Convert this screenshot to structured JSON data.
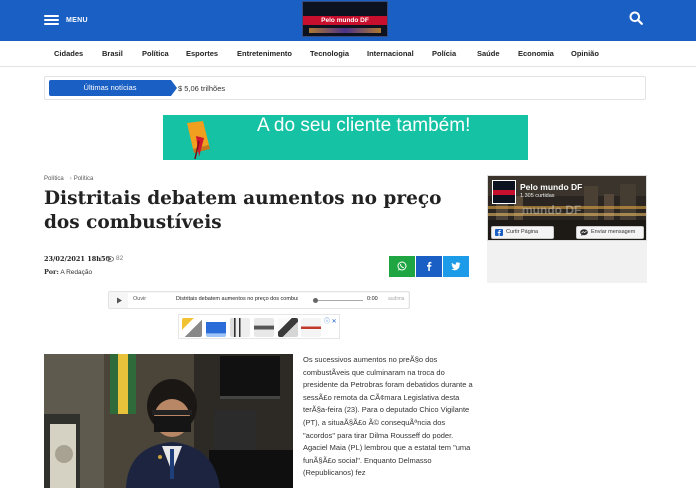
{
  "header": {
    "menu_label": "MENU",
    "logo_text": "Pelo mundo DF",
    "search_icon": "search-icon",
    "colors": {
      "brand_blue": "#1a5fc4",
      "logo_red": "#c8102e"
    }
  },
  "nav": {
    "items": [
      "Cidades",
      "Brasil",
      "Política",
      "Esportes",
      "Entretenimento",
      "Tecnologia",
      "Internacional",
      "Polícia",
      "Saúde",
      "Economia",
      "Opinião"
    ]
  },
  "ticker": {
    "label": "Últimas notícias",
    "text": "$ 5,06 trilhões"
  },
  "ad_banner": {
    "text": "A do seu cliente também!",
    "bg_color": "#15c2a4"
  },
  "article": {
    "breadcrumb": [
      "Política",
      "Política"
    ],
    "title": "Distritais debatem aumentos no preço dos combustíveis",
    "date": "23/02/2021 18h50",
    "views": "82",
    "author_prefix": "Por:",
    "author": "A Redação",
    "share": {
      "whatsapp_icon": "whatsapp-icon",
      "facebook_icon": "facebook-icon",
      "twitter_icon": "twitter-icon"
    },
    "audio": {
      "listen_label": "Ouvir",
      "title": "Distritais debatem aumentos no preço dos combustíveis",
      "time": "0:00",
      "brand": "audima"
    },
    "inline_ad_choice": "ⓘ ✕",
    "body": "Os sucessivos aumentos no preÃ§o dos combustÃveis que culminaram na troca do presidente da Petrobras foram debatidos durante a sessÃ£o remota da CÃ¢mara Legislativa desta terÃ§a-feira (23). Para o deputado Chico Vigilante (PT), a situaÃ§Ã£o Ã© consequÃªncia dos \"acordos\" para tirar Dilma Rousseff do poder. Agaciel Maia (PL) lembrou que a estatal tem \"uma funÃ§Ã£o social\". Enquanto Delmasso (Republicanos) fez"
  },
  "sidebar": {
    "page_name": "Pelo mundo DF",
    "followers": "1.305 curtidas",
    "like_button": "Curtir Página",
    "message_button": "Enviar mensagem"
  }
}
